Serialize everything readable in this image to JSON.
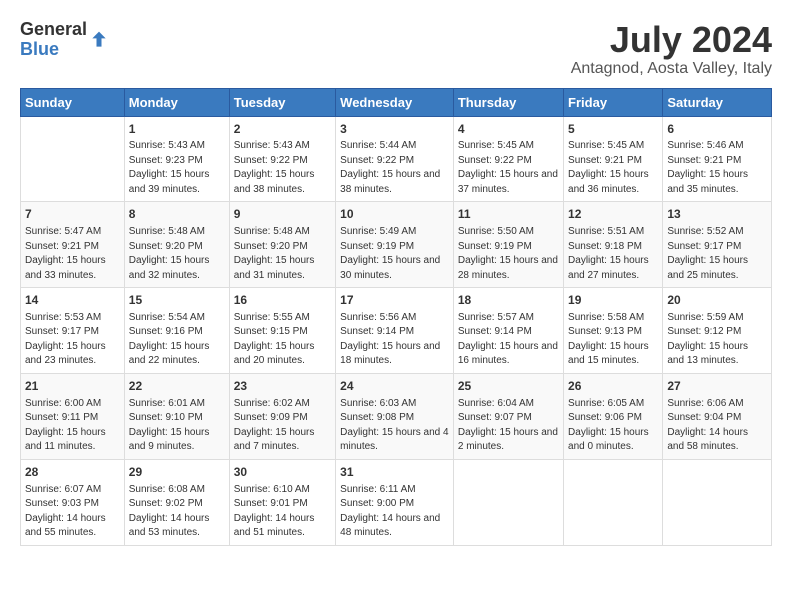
{
  "logo": {
    "general": "General",
    "blue": "Blue"
  },
  "title": {
    "month": "July 2024",
    "location": "Antagnod, Aosta Valley, Italy"
  },
  "calendar": {
    "headers": [
      "Sunday",
      "Monday",
      "Tuesday",
      "Wednesday",
      "Thursday",
      "Friday",
      "Saturday"
    ],
    "weeks": [
      [
        {
          "day": "",
          "sunrise": "",
          "sunset": "",
          "daylight": ""
        },
        {
          "day": "1",
          "sunrise": "Sunrise: 5:43 AM",
          "sunset": "Sunset: 9:23 PM",
          "daylight": "Daylight: 15 hours and 39 minutes."
        },
        {
          "day": "2",
          "sunrise": "Sunrise: 5:43 AM",
          "sunset": "Sunset: 9:22 PM",
          "daylight": "Daylight: 15 hours and 38 minutes."
        },
        {
          "day": "3",
          "sunrise": "Sunrise: 5:44 AM",
          "sunset": "Sunset: 9:22 PM",
          "daylight": "Daylight: 15 hours and 38 minutes."
        },
        {
          "day": "4",
          "sunrise": "Sunrise: 5:45 AM",
          "sunset": "Sunset: 9:22 PM",
          "daylight": "Daylight: 15 hours and 37 minutes."
        },
        {
          "day": "5",
          "sunrise": "Sunrise: 5:45 AM",
          "sunset": "Sunset: 9:21 PM",
          "daylight": "Daylight: 15 hours and 36 minutes."
        },
        {
          "day": "6",
          "sunrise": "Sunrise: 5:46 AM",
          "sunset": "Sunset: 9:21 PM",
          "daylight": "Daylight: 15 hours and 35 minutes."
        }
      ],
      [
        {
          "day": "7",
          "sunrise": "Sunrise: 5:47 AM",
          "sunset": "Sunset: 9:21 PM",
          "daylight": "Daylight: 15 hours and 33 minutes."
        },
        {
          "day": "8",
          "sunrise": "Sunrise: 5:48 AM",
          "sunset": "Sunset: 9:20 PM",
          "daylight": "Daylight: 15 hours and 32 minutes."
        },
        {
          "day": "9",
          "sunrise": "Sunrise: 5:48 AM",
          "sunset": "Sunset: 9:20 PM",
          "daylight": "Daylight: 15 hours and 31 minutes."
        },
        {
          "day": "10",
          "sunrise": "Sunrise: 5:49 AM",
          "sunset": "Sunset: 9:19 PM",
          "daylight": "Daylight: 15 hours and 30 minutes."
        },
        {
          "day": "11",
          "sunrise": "Sunrise: 5:50 AM",
          "sunset": "Sunset: 9:19 PM",
          "daylight": "Daylight: 15 hours and 28 minutes."
        },
        {
          "day": "12",
          "sunrise": "Sunrise: 5:51 AM",
          "sunset": "Sunset: 9:18 PM",
          "daylight": "Daylight: 15 hours and 27 minutes."
        },
        {
          "day": "13",
          "sunrise": "Sunrise: 5:52 AM",
          "sunset": "Sunset: 9:17 PM",
          "daylight": "Daylight: 15 hours and 25 minutes."
        }
      ],
      [
        {
          "day": "14",
          "sunrise": "Sunrise: 5:53 AM",
          "sunset": "Sunset: 9:17 PM",
          "daylight": "Daylight: 15 hours and 23 minutes."
        },
        {
          "day": "15",
          "sunrise": "Sunrise: 5:54 AM",
          "sunset": "Sunset: 9:16 PM",
          "daylight": "Daylight: 15 hours and 22 minutes."
        },
        {
          "day": "16",
          "sunrise": "Sunrise: 5:55 AM",
          "sunset": "Sunset: 9:15 PM",
          "daylight": "Daylight: 15 hours and 20 minutes."
        },
        {
          "day": "17",
          "sunrise": "Sunrise: 5:56 AM",
          "sunset": "Sunset: 9:14 PM",
          "daylight": "Daylight: 15 hours and 18 minutes."
        },
        {
          "day": "18",
          "sunrise": "Sunrise: 5:57 AM",
          "sunset": "Sunset: 9:14 PM",
          "daylight": "Daylight: 15 hours and 16 minutes."
        },
        {
          "day": "19",
          "sunrise": "Sunrise: 5:58 AM",
          "sunset": "Sunset: 9:13 PM",
          "daylight": "Daylight: 15 hours and 15 minutes."
        },
        {
          "day": "20",
          "sunrise": "Sunrise: 5:59 AM",
          "sunset": "Sunset: 9:12 PM",
          "daylight": "Daylight: 15 hours and 13 minutes."
        }
      ],
      [
        {
          "day": "21",
          "sunrise": "Sunrise: 6:00 AM",
          "sunset": "Sunset: 9:11 PM",
          "daylight": "Daylight: 15 hours and 11 minutes."
        },
        {
          "day": "22",
          "sunrise": "Sunrise: 6:01 AM",
          "sunset": "Sunset: 9:10 PM",
          "daylight": "Daylight: 15 hours and 9 minutes."
        },
        {
          "day": "23",
          "sunrise": "Sunrise: 6:02 AM",
          "sunset": "Sunset: 9:09 PM",
          "daylight": "Daylight: 15 hours and 7 minutes."
        },
        {
          "day": "24",
          "sunrise": "Sunrise: 6:03 AM",
          "sunset": "Sunset: 9:08 PM",
          "daylight": "Daylight: 15 hours and 4 minutes."
        },
        {
          "day": "25",
          "sunrise": "Sunrise: 6:04 AM",
          "sunset": "Sunset: 9:07 PM",
          "daylight": "Daylight: 15 hours and 2 minutes."
        },
        {
          "day": "26",
          "sunrise": "Sunrise: 6:05 AM",
          "sunset": "Sunset: 9:06 PM",
          "daylight": "Daylight: 15 hours and 0 minutes."
        },
        {
          "day": "27",
          "sunrise": "Sunrise: 6:06 AM",
          "sunset": "Sunset: 9:04 PM",
          "daylight": "Daylight: 14 hours and 58 minutes."
        }
      ],
      [
        {
          "day": "28",
          "sunrise": "Sunrise: 6:07 AM",
          "sunset": "Sunset: 9:03 PM",
          "daylight": "Daylight: 14 hours and 55 minutes."
        },
        {
          "day": "29",
          "sunrise": "Sunrise: 6:08 AM",
          "sunset": "Sunset: 9:02 PM",
          "daylight": "Daylight: 14 hours and 53 minutes."
        },
        {
          "day": "30",
          "sunrise": "Sunrise: 6:10 AM",
          "sunset": "Sunset: 9:01 PM",
          "daylight": "Daylight: 14 hours and 51 minutes."
        },
        {
          "day": "31",
          "sunrise": "Sunrise: 6:11 AM",
          "sunset": "Sunset: 9:00 PM",
          "daylight": "Daylight: 14 hours and 48 minutes."
        },
        {
          "day": "",
          "sunrise": "",
          "sunset": "",
          "daylight": ""
        },
        {
          "day": "",
          "sunrise": "",
          "sunset": "",
          "daylight": ""
        },
        {
          "day": "",
          "sunrise": "",
          "sunset": "",
          "daylight": ""
        }
      ]
    ]
  }
}
